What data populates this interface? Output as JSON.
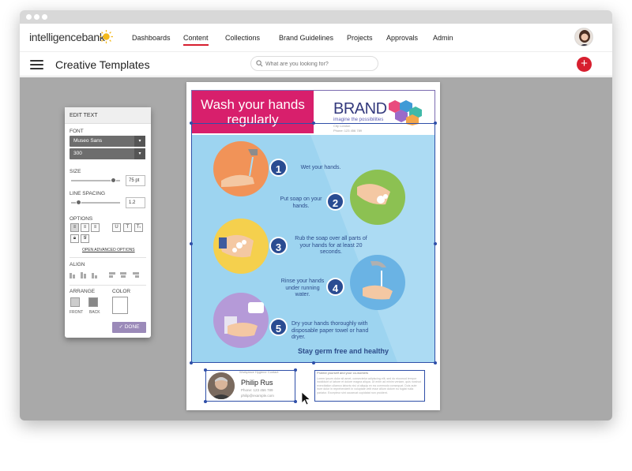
{
  "window": {
    "dots": [
      "",
      "",
      ""
    ]
  },
  "nav": {
    "logo": "intelligencebank",
    "links": [
      "Dashboards",
      "Content",
      "Collections",
      "Brand Guidelines",
      "Projects",
      "Approvals",
      "Admin"
    ],
    "active_link": "Content"
  },
  "subbar": {
    "title": "Creative Templates",
    "search_placeholder": "What are you looking for?",
    "add_label": "+"
  },
  "edit_panel": {
    "header": "EDIT TEXT",
    "font_label": "FONT",
    "font_family": "Museo Sans",
    "font_weight": "300",
    "size_label": "SIZE",
    "size_value": "75 pt",
    "size_level": 0.9,
    "line_spacing_label": "LINE SPACING",
    "line_spacing_value": "1.2",
    "line_spacing_level": 0.1,
    "options_label": "OPTIONS",
    "case_buttons": [
      "U",
      "T",
      "Tₜ"
    ],
    "advanced_link": "OPEN ADVANCED OPTIONS",
    "align_label": "ALIGN",
    "arrange_label": "ARRANGE",
    "color_label": "COLOR",
    "front_label": "FRONT",
    "back_label": "BACK",
    "done_label": "DONE"
  },
  "poster": {
    "title": "Wash your hands regularly",
    "brand": "BRAND",
    "tagline": "imagine the possibilities",
    "contact_line1": "City London",
    "contact_line2": "Phone: 123 456 789",
    "steps": [
      {
        "num": "1",
        "text": "Wet your hands."
      },
      {
        "num": "2",
        "text": "Put soap on your hands."
      },
      {
        "num": "3",
        "text": "Rub the soap over all parts of your hands for at least 20 seconds."
      },
      {
        "num": "4",
        "text": "Rinse your hands under running water."
      },
      {
        "num": "5",
        "text": "Dry your hands thoroughly with disposable paper towel or hand dryer."
      }
    ],
    "slogan": "Stay germ free and healthy"
  },
  "footer": {
    "card_title": "Workplace Hygiene Contact",
    "name": "Philip Rus",
    "phone": "Phone: 123 456 789",
    "email": "philip@example.com",
    "right_title": "Protect yourself and your co-workers",
    "right_body": "Lorem ipsum dolor sit amet, consectetur adipiscing elit, sed do eiusmod tempor incididunt ut labore et dolore magna aliqua. Ut enim ad minim veniam, quis nostrud exercitation ullamco laboris nisi ut aliquip ex ea commodo consequat. Duis aute irure dolor in reprehenderit in voluptate velit esse cillum dolore eu fugiat nulla pariatur. Excepteur sint occaecat cupidatat non proident."
  },
  "colors": {
    "accent": "#d71f2f",
    "title_bg": "#d81f6c",
    "navy": "#2a4c92",
    "selection": "#2f4fa8"
  }
}
